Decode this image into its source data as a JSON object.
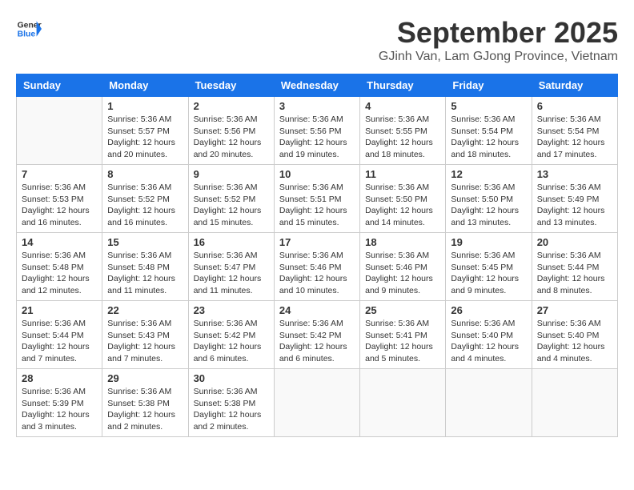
{
  "logo": {
    "line1": "General",
    "line2": "Blue"
  },
  "title": "September 2025",
  "subtitle": "GJinh Van, Lam GJong Province, Vietnam",
  "days": [
    "Sunday",
    "Monday",
    "Tuesday",
    "Wednesday",
    "Thursday",
    "Friday",
    "Saturday"
  ],
  "weeks": [
    [
      {
        "num": "",
        "lines": []
      },
      {
        "num": "1",
        "lines": [
          "Sunrise: 5:36 AM",
          "Sunset: 5:57 PM",
          "Daylight: 12 hours",
          "and 20 minutes."
        ]
      },
      {
        "num": "2",
        "lines": [
          "Sunrise: 5:36 AM",
          "Sunset: 5:56 PM",
          "Daylight: 12 hours",
          "and 20 minutes."
        ]
      },
      {
        "num": "3",
        "lines": [
          "Sunrise: 5:36 AM",
          "Sunset: 5:56 PM",
          "Daylight: 12 hours",
          "and 19 minutes."
        ]
      },
      {
        "num": "4",
        "lines": [
          "Sunrise: 5:36 AM",
          "Sunset: 5:55 PM",
          "Daylight: 12 hours",
          "and 18 minutes."
        ]
      },
      {
        "num": "5",
        "lines": [
          "Sunrise: 5:36 AM",
          "Sunset: 5:54 PM",
          "Daylight: 12 hours",
          "and 18 minutes."
        ]
      },
      {
        "num": "6",
        "lines": [
          "Sunrise: 5:36 AM",
          "Sunset: 5:54 PM",
          "Daylight: 12 hours",
          "and 17 minutes."
        ]
      }
    ],
    [
      {
        "num": "7",
        "lines": [
          "Sunrise: 5:36 AM",
          "Sunset: 5:53 PM",
          "Daylight: 12 hours",
          "and 16 minutes."
        ]
      },
      {
        "num": "8",
        "lines": [
          "Sunrise: 5:36 AM",
          "Sunset: 5:52 PM",
          "Daylight: 12 hours",
          "and 16 minutes."
        ]
      },
      {
        "num": "9",
        "lines": [
          "Sunrise: 5:36 AM",
          "Sunset: 5:52 PM",
          "Daylight: 12 hours",
          "and 15 minutes."
        ]
      },
      {
        "num": "10",
        "lines": [
          "Sunrise: 5:36 AM",
          "Sunset: 5:51 PM",
          "Daylight: 12 hours",
          "and 15 minutes."
        ]
      },
      {
        "num": "11",
        "lines": [
          "Sunrise: 5:36 AM",
          "Sunset: 5:50 PM",
          "Daylight: 12 hours",
          "and 14 minutes."
        ]
      },
      {
        "num": "12",
        "lines": [
          "Sunrise: 5:36 AM",
          "Sunset: 5:50 PM",
          "Daylight: 12 hours",
          "and 13 minutes."
        ]
      },
      {
        "num": "13",
        "lines": [
          "Sunrise: 5:36 AM",
          "Sunset: 5:49 PM",
          "Daylight: 12 hours",
          "and 13 minutes."
        ]
      }
    ],
    [
      {
        "num": "14",
        "lines": [
          "Sunrise: 5:36 AM",
          "Sunset: 5:48 PM",
          "Daylight: 12 hours",
          "and 12 minutes."
        ]
      },
      {
        "num": "15",
        "lines": [
          "Sunrise: 5:36 AM",
          "Sunset: 5:48 PM",
          "Daylight: 12 hours",
          "and 11 minutes."
        ]
      },
      {
        "num": "16",
        "lines": [
          "Sunrise: 5:36 AM",
          "Sunset: 5:47 PM",
          "Daylight: 12 hours",
          "and 11 minutes."
        ]
      },
      {
        "num": "17",
        "lines": [
          "Sunrise: 5:36 AM",
          "Sunset: 5:46 PM",
          "Daylight: 12 hours",
          "and 10 minutes."
        ]
      },
      {
        "num": "18",
        "lines": [
          "Sunrise: 5:36 AM",
          "Sunset: 5:46 PM",
          "Daylight: 12 hours",
          "and 9 minutes."
        ]
      },
      {
        "num": "19",
        "lines": [
          "Sunrise: 5:36 AM",
          "Sunset: 5:45 PM",
          "Daylight: 12 hours",
          "and 9 minutes."
        ]
      },
      {
        "num": "20",
        "lines": [
          "Sunrise: 5:36 AM",
          "Sunset: 5:44 PM",
          "Daylight: 12 hours",
          "and 8 minutes."
        ]
      }
    ],
    [
      {
        "num": "21",
        "lines": [
          "Sunrise: 5:36 AM",
          "Sunset: 5:44 PM",
          "Daylight: 12 hours",
          "and 7 minutes."
        ]
      },
      {
        "num": "22",
        "lines": [
          "Sunrise: 5:36 AM",
          "Sunset: 5:43 PM",
          "Daylight: 12 hours",
          "and 7 minutes."
        ]
      },
      {
        "num": "23",
        "lines": [
          "Sunrise: 5:36 AM",
          "Sunset: 5:42 PM",
          "Daylight: 12 hours",
          "and 6 minutes."
        ]
      },
      {
        "num": "24",
        "lines": [
          "Sunrise: 5:36 AM",
          "Sunset: 5:42 PM",
          "Daylight: 12 hours",
          "and 6 minutes."
        ]
      },
      {
        "num": "25",
        "lines": [
          "Sunrise: 5:36 AM",
          "Sunset: 5:41 PM",
          "Daylight: 12 hours",
          "and 5 minutes."
        ]
      },
      {
        "num": "26",
        "lines": [
          "Sunrise: 5:36 AM",
          "Sunset: 5:40 PM",
          "Daylight: 12 hours",
          "and 4 minutes."
        ]
      },
      {
        "num": "27",
        "lines": [
          "Sunrise: 5:36 AM",
          "Sunset: 5:40 PM",
          "Daylight: 12 hours",
          "and 4 minutes."
        ]
      }
    ],
    [
      {
        "num": "28",
        "lines": [
          "Sunrise: 5:36 AM",
          "Sunset: 5:39 PM",
          "Daylight: 12 hours",
          "and 3 minutes."
        ]
      },
      {
        "num": "29",
        "lines": [
          "Sunrise: 5:36 AM",
          "Sunset: 5:38 PM",
          "Daylight: 12 hours",
          "and 2 minutes."
        ]
      },
      {
        "num": "30",
        "lines": [
          "Sunrise: 5:36 AM",
          "Sunset: 5:38 PM",
          "Daylight: 12 hours",
          "and 2 minutes."
        ]
      },
      {
        "num": "",
        "lines": []
      },
      {
        "num": "",
        "lines": []
      },
      {
        "num": "",
        "lines": []
      },
      {
        "num": "",
        "lines": []
      }
    ]
  ]
}
